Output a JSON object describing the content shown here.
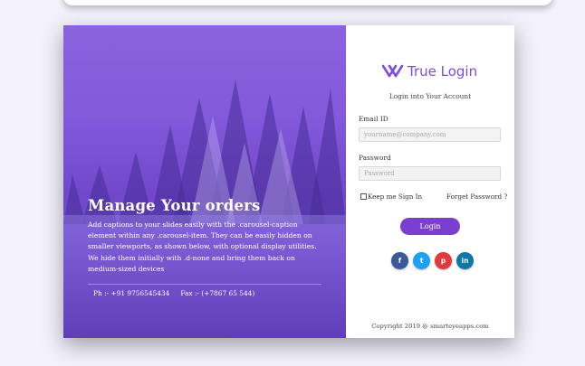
{
  "hero": {
    "title": "Manage Your orders",
    "text": "Add captions to your slides easily with the .carousel-caption element within any .carousel-item. They can be easily hidden on smaller viewports, as shown below, with optional display utilities. We hide them initially with .d-none and bring them back on medium-sized devices",
    "phone": "Ph :- +91 9756545434",
    "fax": "Fax :- (+7867 65 544)"
  },
  "brand": {
    "name": "True Login",
    "color": "#7a4fd6"
  },
  "form": {
    "subtitle": "Login into Your Account",
    "email_label": "Email ID",
    "email_placeholder": "yourname@company.com",
    "password_label": "Password",
    "password_placeholder": "Password",
    "remember_label": "Keep me Sign In",
    "forgot_label": "Forget Password ?",
    "login_label": "Login",
    "button_color": "#7b3fd0"
  },
  "socials": [
    {
      "name": "facebook-icon",
      "glyph": "f",
      "color": "#3b5998"
    },
    {
      "name": "twitter-icon",
      "glyph": "t",
      "color": "#1da1f2"
    },
    {
      "name": "pinterest-icon",
      "glyph": "p",
      "color": "#e0393e"
    },
    {
      "name": "linkedin-icon",
      "glyph": "in",
      "color": "#0e76a8"
    }
  ],
  "footer": {
    "copyright": "Copyright 2019 @ smarteyeapps.com"
  }
}
